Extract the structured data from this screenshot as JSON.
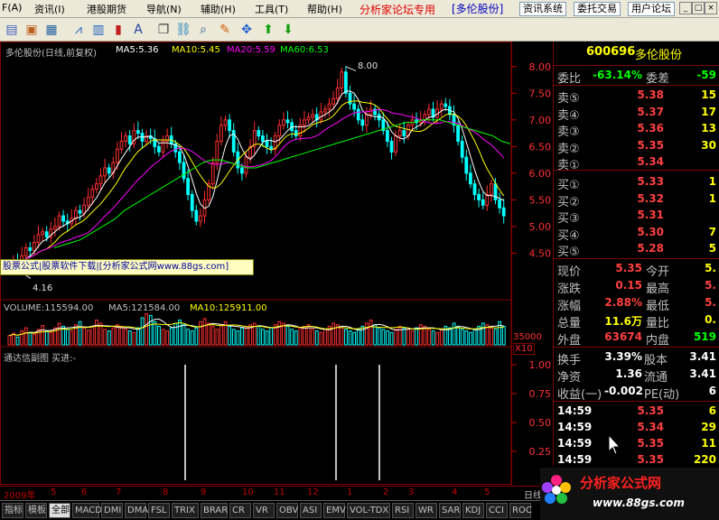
{
  "menu": {
    "items": [
      "F(A)",
      "资讯(I)",
      "港股期货",
      "导航(N)",
      "辅助(H)",
      "工具(T)",
      "帮助(H)"
    ],
    "forum_title": "分析家论坛专用",
    "forum_stock": "[多伦股份]",
    "buttons": [
      "资讯系统",
      "委托交易",
      "用户论坛"
    ],
    "window_controls": [
      "_",
      "□",
      "×"
    ]
  },
  "toolbar": {
    "icons": [
      "doc-icon",
      "picture-icon",
      "grid-icon",
      "line-chart-icon",
      "bar-chart-icon",
      "candle-icon",
      "text-icon",
      "clone-icon",
      "link-icon",
      "search-icon",
      "pencil-icon",
      "move-icon",
      "arrow-up-icon",
      "arrow-down-icon"
    ]
  },
  "chart": {
    "title": "多伦股份(日线,前复权)",
    "ma_legend": [
      {
        "label": "MA5:5.36",
        "color": "#ffffff"
      },
      {
        "label": "MA10:5.45",
        "color": "#ffff00"
      },
      {
        "label": "MA20:5.59",
        "color": "#ff00ff"
      },
      {
        "label": "MA60:6.53",
        "color": "#00ff00"
      }
    ],
    "high_label": "8.00",
    "low_label": "4.16",
    "ad_text": "股票公式|股票软件下载|[分析家公式网www.88gs.com]",
    "volume_legend": [
      {
        "label": "VOLUME:115594.00",
        "color": "#ffffff"
      },
      {
        "label": "MA5:121584.00",
        "color": "#ffffff"
      },
      {
        "label": "MA10:125911.00",
        "color": "#ffff00"
      }
    ],
    "volume_scale_value": "35000",
    "volume_scale_unit": "X10",
    "indicator_legend": "通达信副图  买进:-",
    "date_ticks": [
      "2009年",
      "5",
      "6",
      "7",
      "8",
      "9",
      "10",
      "11",
      "12",
      "1",
      "2",
      "3",
      "4",
      "5"
    ],
    "right_label": "日线"
  },
  "chart_data": {
    "type": "candlestick",
    "price_axis": {
      "ticks": [
        8.0,
        7.5,
        7.0,
        6.5,
        6.0,
        5.5,
        5.0,
        4.5
      ],
      "ylim": [
        4.1,
        8.2
      ]
    },
    "close": [
      4.3,
      4.35,
      4.28,
      4.45,
      4.6,
      4.55,
      4.7,
      4.85,
      4.9,
      4.8,
      4.95,
      5.0,
      5.2,
      5.1,
      5.05,
      5.15,
      5.3,
      5.25,
      5.4,
      5.55,
      5.7,
      5.8,
      5.95,
      6.1,
      6.0,
      6.2,
      6.45,
      6.6,
      6.7,
      6.55,
      6.8,
      6.75,
      6.6,
      6.7,
      6.65,
      6.5,
      6.4,
      6.6,
      6.7,
      6.55,
      6.4,
      6.2,
      5.9,
      5.6,
      5.3,
      5.1,
      5.2,
      5.5,
      5.8,
      6.2,
      6.6,
      6.9,
      7.0,
      6.8,
      6.4,
      6.1,
      6.0,
      6.3,
      6.5,
      6.8,
      6.7,
      6.6,
      6.5,
      6.45,
      6.7,
      6.9,
      7.0,
      6.95,
      6.8,
      6.7,
      6.9,
      7.0,
      7.05,
      7.1,
      7.0,
      7.15,
      7.2,
      7.3,
      7.4,
      7.6,
      7.9,
      7.5,
      7.3,
      7.2,
      7.0,
      6.9,
      7.1,
      7.2,
      7.1,
      7.0,
      6.8,
      6.6,
      6.4,
      6.7,
      6.8,
      6.7,
      6.9,
      7.0,
      6.95,
      7.0,
      7.1,
      7.2,
      7.05,
      7.2,
      7.3,
      7.25,
      7.1,
      6.9,
      6.6,
      6.3,
      6.0,
      5.8,
      5.6,
      5.5,
      5.4,
      5.6,
      5.8,
      5.5,
      5.35,
      5.2
    ],
    "ma60": [
      4.6,
      4.65,
      4.7,
      4.75,
      4.85,
      4.95,
      5.05,
      5.15,
      5.3,
      5.4,
      5.5,
      5.6,
      5.7,
      5.8,
      5.9,
      6.0,
      6.1,
      6.2,
      6.25,
      6.25,
      6.2,
      6.15,
      6.1,
      6.1,
      6.15,
      6.2,
      6.25,
      6.3,
      6.35,
      6.4,
      6.45,
      6.5,
      6.55,
      6.6,
      6.65,
      6.7,
      6.75,
      6.8,
      6.85,
      6.9,
      6.95,
      6.95,
      7.0,
      7.0,
      7.0,
      6.95,
      6.9,
      6.85,
      6.8,
      6.75,
      6.7,
      6.6,
      6.55
    ],
    "volume": [
      12,
      15,
      10,
      18,
      22,
      16,
      14,
      20,
      25,
      18,
      16,
      22,
      28,
      24,
      20,
      18,
      26,
      30,
      22,
      19,
      24,
      32,
      28,
      20,
      18,
      22,
      26,
      24,
      20,
      18,
      16,
      22,
      35,
      40,
      38,
      30,
      24,
      20,
      18,
      22,
      28,
      32,
      26,
      20,
      18,
      22,
      30,
      34,
      28,
      24,
      20,
      26,
      30,
      24,
      20,
      18,
      22,
      24,
      26,
      28,
      24,
      20,
      18,
      22,
      26,
      30,
      28,
      24,
      20,
      18,
      22,
      24,
      26,
      20,
      18,
      16,
      20,
      24,
      28,
      26,
      22,
      20,
      18,
      16,
      20,
      24,
      28,
      32,
      26,
      22,
      20,
      18,
      16,
      20,
      24,
      22,
      20,
      18,
      22,
      26,
      24,
      20,
      18,
      16,
      20,
      24,
      22,
      28,
      24,
      20,
      18,
      16,
      20,
      24,
      28,
      26,
      22,
      20,
      30,
      24
    ],
    "signals_x": [
      205,
      372,
      420
    ]
  },
  "quote": {
    "code": "600696",
    "name": "多伦股份",
    "weibi_label": "委比",
    "weibi_value": "-63.14%",
    "weicha_label": "委差",
    "weicha_value": "-59",
    "sell": [
      {
        "label": "卖⑤",
        "price": "5.38",
        "vol": "15"
      },
      {
        "label": "卖④",
        "price": "5.37",
        "vol": "17"
      },
      {
        "label": "卖③",
        "price": "5.36",
        "vol": "13"
      },
      {
        "label": "卖②",
        "price": "5.35",
        "vol": "30"
      },
      {
        "label": "卖①",
        "price": "5.34",
        "vol": ""
      }
    ],
    "buy": [
      {
        "label": "买①",
        "price": "5.33",
        "vol": "1"
      },
      {
        "label": "买②",
        "price": "5.32",
        "vol": "1"
      },
      {
        "label": "买③",
        "price": "5.31",
        "vol": ""
      },
      {
        "label": "买④",
        "price": "5.30",
        "vol": "7"
      },
      {
        "label": "买⑤",
        "price": "5.28",
        "vol": "5"
      }
    ],
    "stats": [
      {
        "l1": "现价",
        "v1": "5.35",
        "c1": "#ff4040",
        "l2": "今开",
        "v2": "5.",
        "c2": "#ffff00"
      },
      {
        "l1": "涨跌",
        "v1": "0.15",
        "c1": "#ff4040",
        "l2": "最高",
        "v2": "5.",
        "c2": "#ff4040"
      },
      {
        "l1": "涨幅",
        "v1": "2.88%",
        "c1": "#ff4040",
        "l2": "最低",
        "v2": "5.",
        "c2": "#ff4040"
      },
      {
        "l1": "总量",
        "v1": "11.6万",
        "c1": "#ffff00",
        "l2": "量比",
        "v2": "0.",
        "c2": "#ffff00"
      },
      {
        "l1": "外盘",
        "v1": "63674",
        "c1": "#ff4040",
        "l2": "内盘",
        "v2": "519",
        "c2": "#00ff00"
      }
    ],
    "stats2": [
      {
        "l1": "换手",
        "v1": "3.39%",
        "l2": "股本",
        "v2": "3.41"
      },
      {
        "l1": "净资",
        "v1": "1.36",
        "l2": "流通",
        "v2": "3.41"
      },
      {
        "l1": "收益(一)",
        "v1": "-0.002",
        "l2": "PE(动)",
        "v2": "6"
      }
    ],
    "ticks": [
      {
        "time": "14:59",
        "price": "5.35",
        "vol": "6"
      },
      {
        "time": "14:59",
        "price": "5.34",
        "vol": "29"
      },
      {
        "time": "14:59",
        "price": "5.35",
        "vol": "11"
      },
      {
        "time": "14:59",
        "price": "5.35",
        "vol": "220"
      }
    ]
  },
  "tabs": [
    "指标",
    "模板",
    "全部",
    "MACD",
    "DMI",
    "DMA",
    "FSL",
    "TRIX",
    "BRAR",
    "CR",
    "VR",
    "OBV",
    "ASI",
    "EMV",
    "VOL-TDX",
    "RSI",
    "WR",
    "SAR",
    "KDJ",
    "CCI",
    "ROC"
  ],
  "watermark": {
    "title": "分析家公式网",
    "url": "www.88gs.com"
  }
}
